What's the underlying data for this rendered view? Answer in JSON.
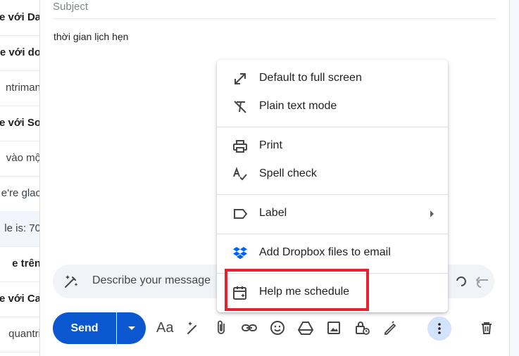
{
  "inbox_rows": [
    {
      "text": "e với Da",
      "bold": true,
      "shade": false
    },
    {
      "text": "e với do",
      "bold": true,
      "shade": false
    },
    {
      "text": "ntriman",
      "bold": false,
      "shade": false
    },
    {
      "text": "e với So",
      "bold": true,
      "shade": false
    },
    {
      "text": "vào mộ",
      "bold": false,
      "shade": false
    },
    {
      "text": "e're glac",
      "bold": false,
      "shade": false
    },
    {
      "text": "le is: 70",
      "bold": false,
      "shade": true
    },
    {
      "text": "e trên",
      "bold": true,
      "shade": false
    },
    {
      "text": "e với Ca",
      "bold": true,
      "shade": false
    },
    {
      "text": "quantri",
      "bold": false,
      "shade": false
    }
  ],
  "compose": {
    "subject_placeholder": "Subject",
    "body_text": "thời gian lịch hẹn",
    "help_me_write_placeholder": "Describe your message"
  },
  "toolbar": {
    "send_label": "Send",
    "formatting_label": "Aa"
  },
  "menu": {
    "items": [
      {
        "label": "Default to full screen",
        "icon": "fullscreen-icon"
      },
      {
        "label": "Plain text mode",
        "icon": "plain-text-icon"
      },
      {
        "label": "Print",
        "icon": "print-icon"
      },
      {
        "label": "Spell check",
        "icon": "spell-check-icon"
      },
      {
        "label": "Label",
        "icon": "label-icon"
      },
      {
        "label": "Add Dropbox files to email",
        "icon": "dropbox-icon"
      },
      {
        "label": "Help me schedule",
        "icon": "calendar-schedule-icon"
      }
    ]
  },
  "colors": {
    "send_blue": "#0b57d0",
    "highlight_red": "#e7212e",
    "dropbox_blue": "#0061fe"
  }
}
